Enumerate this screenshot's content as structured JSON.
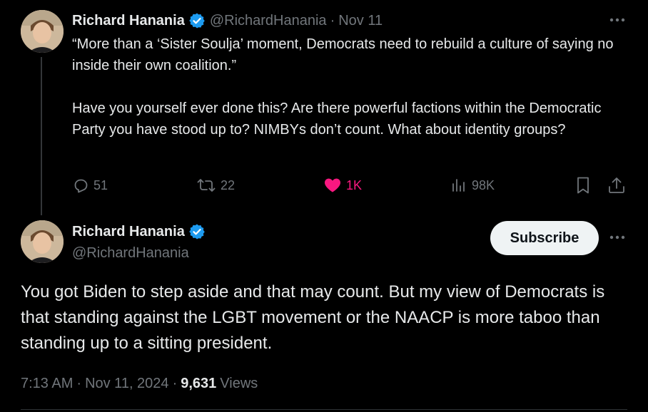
{
  "colors": {
    "background": "#000000",
    "text_primary": "#e7e9ea",
    "text_muted": "#71767b",
    "verified": "#1d9bf0",
    "like": "#f91880",
    "subscribe_bg": "#eff3f4"
  },
  "parent_tweet": {
    "author": {
      "display_name": "Richard Hanania",
      "handle": "@RichardHanania",
      "verified_icon": "verified-badge-icon",
      "avatar_icon": "avatar"
    },
    "separator": "·",
    "date": "Nov 11",
    "more_icon": "more-horizontal-icon",
    "text_paragraphs": [
      "“More than a ‘Sister Soulja’ moment, Democrats need to rebuild a culture of saying no inside their own coalition.”",
      "Have you yourself ever done this? Are there powerful factions within the Democratic Party you have stood up to? NIMBYs don’t count. What about identity groups?"
    ],
    "actions": {
      "reply": {
        "icon": "reply-icon",
        "count": "51"
      },
      "retweet": {
        "icon": "retweet-icon",
        "count": "22"
      },
      "like": {
        "icon": "heart-filled-icon",
        "count": "1K",
        "liked": true
      },
      "views": {
        "icon": "views-chart-icon",
        "count": "98K"
      },
      "bookmark": {
        "icon": "bookmark-icon"
      },
      "share": {
        "icon": "share-icon"
      }
    }
  },
  "main_tweet": {
    "author": {
      "display_name": "Richard Hanania",
      "handle": "@RichardHanania",
      "verified_icon": "verified-badge-icon",
      "avatar_icon": "avatar"
    },
    "subscribe_label": "Subscribe",
    "more_icon": "more-horizontal-icon",
    "text": "You got Biden to step aside and that may count. But my view of Democrats is that standing against the LGBT movement or the NAACP is more taboo than standing up to a sitting president.",
    "time": "7:13 AM",
    "separator": "·",
    "date": "Nov 11, 2024",
    "views_count": "9,631",
    "views_label": "Views"
  }
}
